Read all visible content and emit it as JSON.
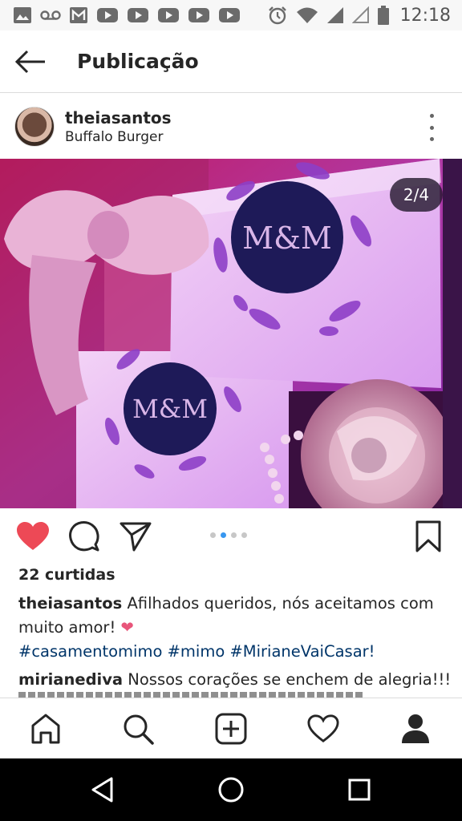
{
  "status_bar": {
    "time": "12:18",
    "left_icons": [
      "image-icon",
      "voicemail-icon",
      "gmail-icon",
      "youtube-icon",
      "youtube-icon",
      "youtube-icon",
      "youtube-icon",
      "youtube-icon"
    ],
    "right_icons": [
      "alarm-icon",
      "wifi-icon",
      "signal-icon",
      "signal-empty-icon",
      "battery-icon"
    ]
  },
  "top_bar": {
    "back_icon": "arrow-left-icon",
    "title": "Publicação"
  },
  "post": {
    "username": "theiasantos",
    "location": "Buffalo Burger",
    "more_icon": "more-vertical-icon",
    "carousel": {
      "current": 2,
      "total": 4,
      "counter_text": "2/4",
      "dot_count": 4,
      "active_dot": 2
    },
    "photo_text": {
      "monogram_1": "M&M",
      "monogram_2": "M&M"
    },
    "actions": {
      "like_icon": "heart-filled-icon",
      "comment_icon": "comment-icon",
      "share_icon": "send-icon",
      "save_icon": "bookmark-icon"
    },
    "likes": "22 curtidas",
    "caption": {
      "username": "theiasantos",
      "text": " Afilhados queridos, nós aceitamos com muito amor! ",
      "emoji": "❤",
      "hashtags": "#casamentomimo #mimo #MirianeVaiCasar!"
    },
    "comments": [
      {
        "username": "mirianediva",
        "text": " Nossos corações se enchem de alegria!!!"
      }
    ]
  },
  "tab_bar": {
    "items": [
      {
        "name": "home",
        "icon": "home-icon"
      },
      {
        "name": "search",
        "icon": "search-icon"
      },
      {
        "name": "new-post",
        "icon": "add-post-icon"
      },
      {
        "name": "activity",
        "icon": "heart-outline-icon"
      },
      {
        "name": "profile",
        "icon": "profile-icon"
      }
    ]
  },
  "nav_bar": {
    "items": [
      "back-triangle-icon",
      "home-circle-icon",
      "recents-square-icon"
    ]
  },
  "colors": {
    "like_red": "#ed4956",
    "link_blue": "#003569",
    "active_dot": "#3897f0",
    "text": "#262626"
  }
}
